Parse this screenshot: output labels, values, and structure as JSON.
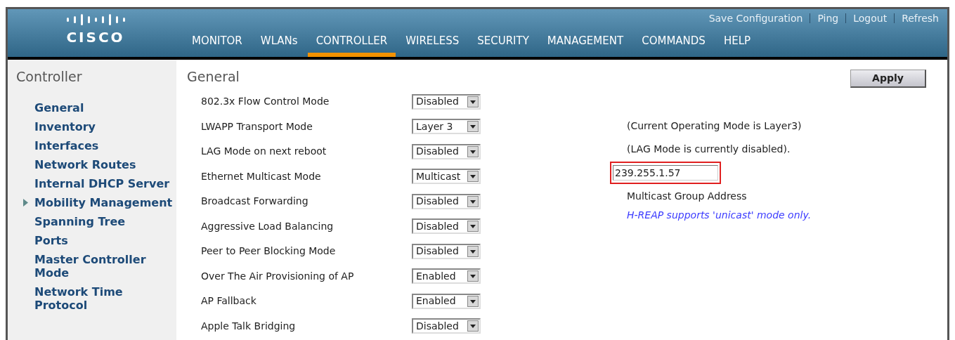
{
  "header": {
    "logo": "CISCO",
    "top_links": [
      "Save Configuration",
      "Ping",
      "Logout",
      "Refresh"
    ],
    "nav": [
      {
        "label": "MONITOR",
        "selected": false
      },
      {
        "label": "WLANs",
        "selected": false
      },
      {
        "label": "CONTROLLER",
        "selected": true
      },
      {
        "label": "WIRELESS",
        "selected": false
      },
      {
        "label": "SECURITY",
        "selected": false
      },
      {
        "label": "MANAGEMENT",
        "selected": false
      },
      {
        "label": "COMMANDS",
        "selected": false
      },
      {
        "label": "HELP",
        "selected": false
      }
    ]
  },
  "sidebar": {
    "title": "Controller",
    "items": [
      {
        "label": "General",
        "expandable": false
      },
      {
        "label": "Inventory",
        "expandable": false
      },
      {
        "label": "Interfaces",
        "expandable": false
      },
      {
        "label": "Network Routes",
        "expandable": false
      },
      {
        "label": "Internal DHCP Server",
        "expandable": false
      },
      {
        "label": "Mobility Management",
        "expandable": true
      },
      {
        "label": "Spanning Tree",
        "expandable": false
      },
      {
        "label": "Ports",
        "expandable": false
      },
      {
        "label": "Master Controller Mode",
        "expandable": false
      },
      {
        "label": "Network Time Protocol",
        "expandable": false
      }
    ]
  },
  "main": {
    "title": "General",
    "apply_button": "Apply",
    "settings": [
      {
        "label": "802.3x Flow Control Mode",
        "value": "Disabled"
      },
      {
        "label": "LWAPP Transport Mode",
        "value": "Layer 3"
      },
      {
        "label": "LAG Mode on next reboot",
        "value": "Disabled"
      },
      {
        "label": "Ethernet Multicast Mode",
        "value": "Multicast"
      },
      {
        "label": "Broadcast Forwarding",
        "value": "Disabled"
      },
      {
        "label": "Aggressive Load Balancing",
        "value": "Disabled"
      },
      {
        "label": "Peer to Peer Blocking Mode",
        "value": "Disabled"
      },
      {
        "label": "Over The Air Provisioning of AP",
        "value": "Enabled"
      },
      {
        "label": "AP Fallback",
        "value": "Enabled"
      },
      {
        "label": "Apple Talk Bridging",
        "value": "Disabled"
      }
    ],
    "notes": [
      {
        "kind": "text",
        "text": "(Current Operating Mode is Layer3)"
      },
      {
        "kind": "text",
        "text": "(LAG Mode is currently disabled)."
      },
      {
        "kind": "field",
        "value": "239.255.1.57",
        "highlighted": true
      },
      {
        "kind": "text",
        "text": "Multicast Group Address"
      },
      {
        "kind": "hint",
        "text": "H-REAP supports 'unicast' mode only."
      }
    ]
  }
}
